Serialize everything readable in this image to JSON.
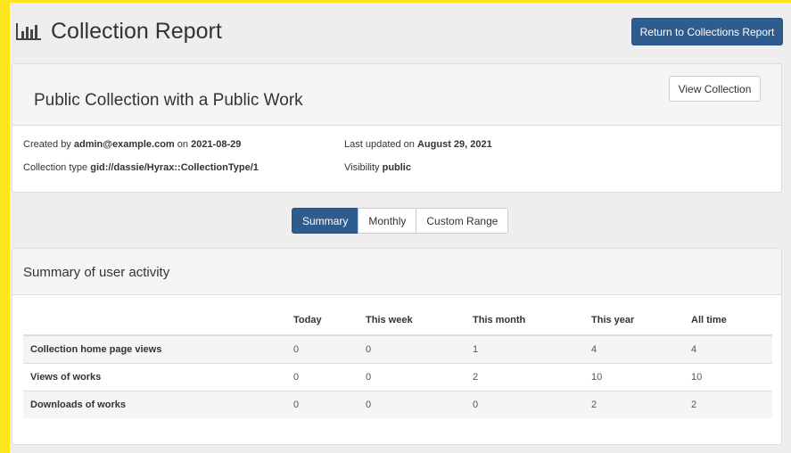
{
  "header": {
    "title": "Collection Report",
    "icon": "bar-chart-icon",
    "return_button": "Return to Collections Report"
  },
  "collection": {
    "title": "Public Collection with a Public Work",
    "view_button": "View Collection",
    "created_prefix": "Created by",
    "created_by": "admin@example.com",
    "created_on_label": "on",
    "created_date": "2021-08-29",
    "type_label": "Collection type",
    "type_value": "gid://dassie/Hyrax::CollectionType/1",
    "updated_label": "Last updated on",
    "updated_date": "August 29, 2021",
    "visibility_label": "Visibility",
    "visibility_value": "public"
  },
  "tabs": [
    {
      "label": "Summary",
      "active": true
    },
    {
      "label": "Monthly",
      "active": false
    },
    {
      "label": "Custom Range",
      "active": false
    }
  ],
  "summary": {
    "heading": "Summary of user activity",
    "columns": [
      "",
      "Today",
      "This week",
      "This month",
      "This year",
      "All time"
    ],
    "rows": [
      {
        "label": "Collection home page views",
        "values": [
          "0",
          "0",
          "1",
          "4",
          "4"
        ]
      },
      {
        "label": "Views of works",
        "values": [
          "0",
          "0",
          "2",
          "10",
          "10"
        ]
      },
      {
        "label": "Downloads of works",
        "values": [
          "0",
          "0",
          "0",
          "2",
          "2"
        ]
      }
    ]
  },
  "colors": {
    "frame": "#fde51c",
    "primary": "#2f5c8f",
    "background": "#eeeeee"
  }
}
